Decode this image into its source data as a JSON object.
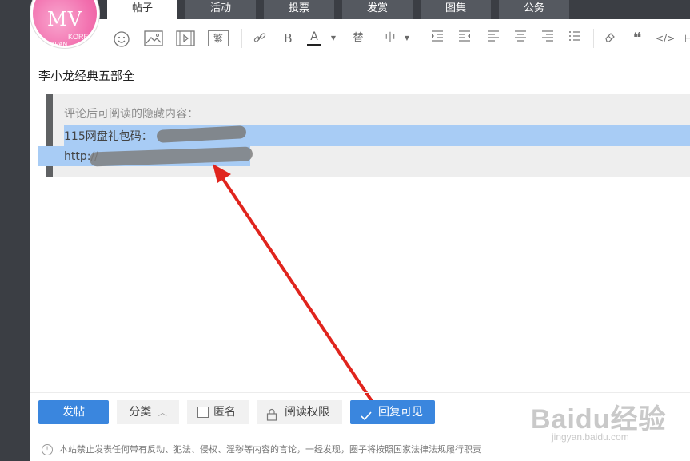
{
  "tabs": [
    "帖子",
    "活动",
    "投票",
    "发赏",
    "图集",
    "公务"
  ],
  "avatar": {
    "big": "MV",
    "korea": "KOREA",
    "japan": "JAPAN"
  },
  "toolbar": {
    "bold": "B",
    "font_color": "A",
    "replace": "替",
    "size": "中",
    "traditional": "繁",
    "quote": "❝",
    "code": "</>"
  },
  "post": {
    "title": "李小龙经典五部全",
    "hidden_label": "评论后可阅读的隐藏内容：",
    "line1_prefix": "115网盘礼包码：",
    "line2_prefix": "http://"
  },
  "bottom": {
    "post_button": "发帖",
    "category_button": "分类",
    "anonymous": "匿名",
    "read_permission": "阅读权限",
    "reply_visible": "回复可见",
    "disclaimer": "本站禁止发表任何带有反动、犯法、侵权、淫秽等内容的言论，一经发现，圈子将按照国家法律法规履行职责"
  },
  "watermark": {
    "text": "Baidu经验",
    "url": "jingyan.baidu.com"
  },
  "colors": {
    "primary": "#3a86de",
    "selection": "#a8ccf5",
    "arrow": "#e0241d"
  }
}
